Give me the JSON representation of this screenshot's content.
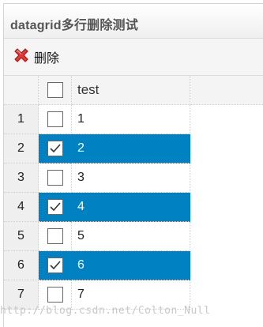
{
  "panel": {
    "title": "datagrid多行删除测试"
  },
  "toolbar": {
    "delete_label": "删除",
    "delete_icon": "remove-icon"
  },
  "grid": {
    "header": {
      "column_label": "test"
    },
    "rows": [
      {
        "num": "1",
        "value": "1",
        "checked": false
      },
      {
        "num": "2",
        "value": "2",
        "checked": true
      },
      {
        "num": "3",
        "value": "3",
        "checked": false
      },
      {
        "num": "4",
        "value": "4",
        "checked": true
      },
      {
        "num": "5",
        "value": "5",
        "checked": false
      },
      {
        "num": "6",
        "value": "6",
        "checked": true
      },
      {
        "num": "7",
        "value": "7",
        "checked": false
      }
    ]
  },
  "colors": {
    "selection": "#0081c2",
    "row_number_bg": "#efefef"
  },
  "watermark": "http://blog.csdn.net/Colton_Null"
}
